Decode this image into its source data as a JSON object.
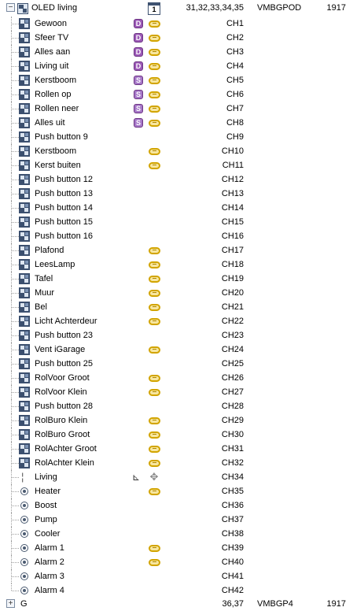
{
  "parent": {
    "name": "OLED living",
    "calendar_icon_text": "1",
    "channels": "31,32,33,34,35",
    "model": "VMBGPOD",
    "number": "1917"
  },
  "rows": [
    {
      "label": "Gewoon",
      "badge": "D",
      "link": true,
      "ch": "CH1"
    },
    {
      "label": "Sfeer TV",
      "badge": "D",
      "link": true,
      "ch": "CH2"
    },
    {
      "label": "Alles aan",
      "badge": "D",
      "link": true,
      "ch": "CH3"
    },
    {
      "label": "Living uit",
      "badge": "D",
      "link": true,
      "ch": "CH4"
    },
    {
      "label": "Kerstboom",
      "badge": "S",
      "link": true,
      "ch": "CH5"
    },
    {
      "label": "Rollen op",
      "badge": "S",
      "link": true,
      "ch": "CH6"
    },
    {
      "label": "Rollen neer",
      "badge": "S",
      "link": true,
      "ch": "CH7"
    },
    {
      "label": "Alles uit",
      "badge": "S",
      "link": true,
      "ch": "CH8"
    },
    {
      "label": "Push button 9",
      "badge": "",
      "link": false,
      "ch": "CH9"
    },
    {
      "label": "Kerstboom",
      "badge": "",
      "link": true,
      "ch": "CH10"
    },
    {
      "label": "Kerst buiten",
      "badge": "",
      "link": true,
      "ch": "CH11"
    },
    {
      "label": "Push button 12",
      "badge": "",
      "link": false,
      "ch": "CH12"
    },
    {
      "label": "Push button 13",
      "badge": "",
      "link": false,
      "ch": "CH13"
    },
    {
      "label": "Push button 14",
      "badge": "",
      "link": false,
      "ch": "CH14"
    },
    {
      "label": "Push button 15",
      "badge": "",
      "link": false,
      "ch": "CH15"
    },
    {
      "label": "Push button 16",
      "badge": "",
      "link": false,
      "ch": "CH16"
    },
    {
      "label": "Plafond",
      "badge": "",
      "link": true,
      "ch": "CH17"
    },
    {
      "label": "LeesLamp",
      "badge": "",
      "link": true,
      "ch": "CH18"
    },
    {
      "label": "Tafel",
      "badge": "",
      "link": true,
      "ch": "CH19"
    },
    {
      "label": "Muur",
      "badge": "",
      "link": true,
      "ch": "CH20"
    },
    {
      "label": "Bel",
      "badge": "",
      "link": true,
      "ch": "CH21"
    },
    {
      "label": "Licht Achterdeur",
      "badge": "",
      "link": true,
      "ch": "CH22"
    },
    {
      "label": "Push button 23",
      "badge": "",
      "link": false,
      "ch": "CH23"
    },
    {
      "label": "Vent iGarage",
      "badge": "",
      "link": true,
      "ch": "CH24"
    },
    {
      "label": "Push button 25",
      "badge": "",
      "link": false,
      "ch": "CH25"
    },
    {
      "label": "RolVoor Groot",
      "badge": "",
      "link": true,
      "ch": "CH26"
    },
    {
      "label": "RolVoor Klein",
      "badge": "",
      "link": true,
      "ch": "CH27"
    },
    {
      "label": "Push button 28",
      "badge": "",
      "link": false,
      "ch": "CH28"
    },
    {
      "label": "RolBuro Klein",
      "badge": "",
      "link": true,
      "ch": "CH29"
    },
    {
      "label": "RolBuro Groot",
      "badge": "",
      "link": true,
      "ch": "CH30"
    },
    {
      "label": "RolAchter Groot",
      "badge": "",
      "link": true,
      "ch": "CH31"
    },
    {
      "label": "RolAchter Klein",
      "badge": "",
      "link": true,
      "ch": "CH32"
    }
  ],
  "thermostat": {
    "label": "Living",
    "ch": "CH34"
  },
  "outputs": [
    {
      "label": "Heater",
      "link": true,
      "ch": "CH35"
    },
    {
      "label": "Boost",
      "link": false,
      "ch": "CH36"
    },
    {
      "label": "Pump",
      "link": false,
      "ch": "CH37"
    },
    {
      "label": "Cooler",
      "link": false,
      "ch": "CH38"
    },
    {
      "label": "Alarm 1",
      "link": true,
      "ch": "CH39"
    },
    {
      "label": "Alarm 2",
      "link": true,
      "ch": "CH40"
    },
    {
      "label": "Alarm 3",
      "link": false,
      "ch": "CH41"
    },
    {
      "label": "Alarm 4",
      "link": false,
      "ch": "CH42"
    }
  ],
  "next_parent": {
    "name": "G",
    "channels": "36,37",
    "model": "VMBGP4",
    "number": "1917"
  },
  "icons": {
    "button_row_icon": "push-button-icon",
    "link_icon": "link-chain-icon",
    "thermostat_icon": "thermometer-icon",
    "output_icon": "radio-output-icon",
    "calendar_icon": "calendar-icon",
    "gauge_icon": "gauge-icon",
    "move_icon": "move-icon"
  }
}
